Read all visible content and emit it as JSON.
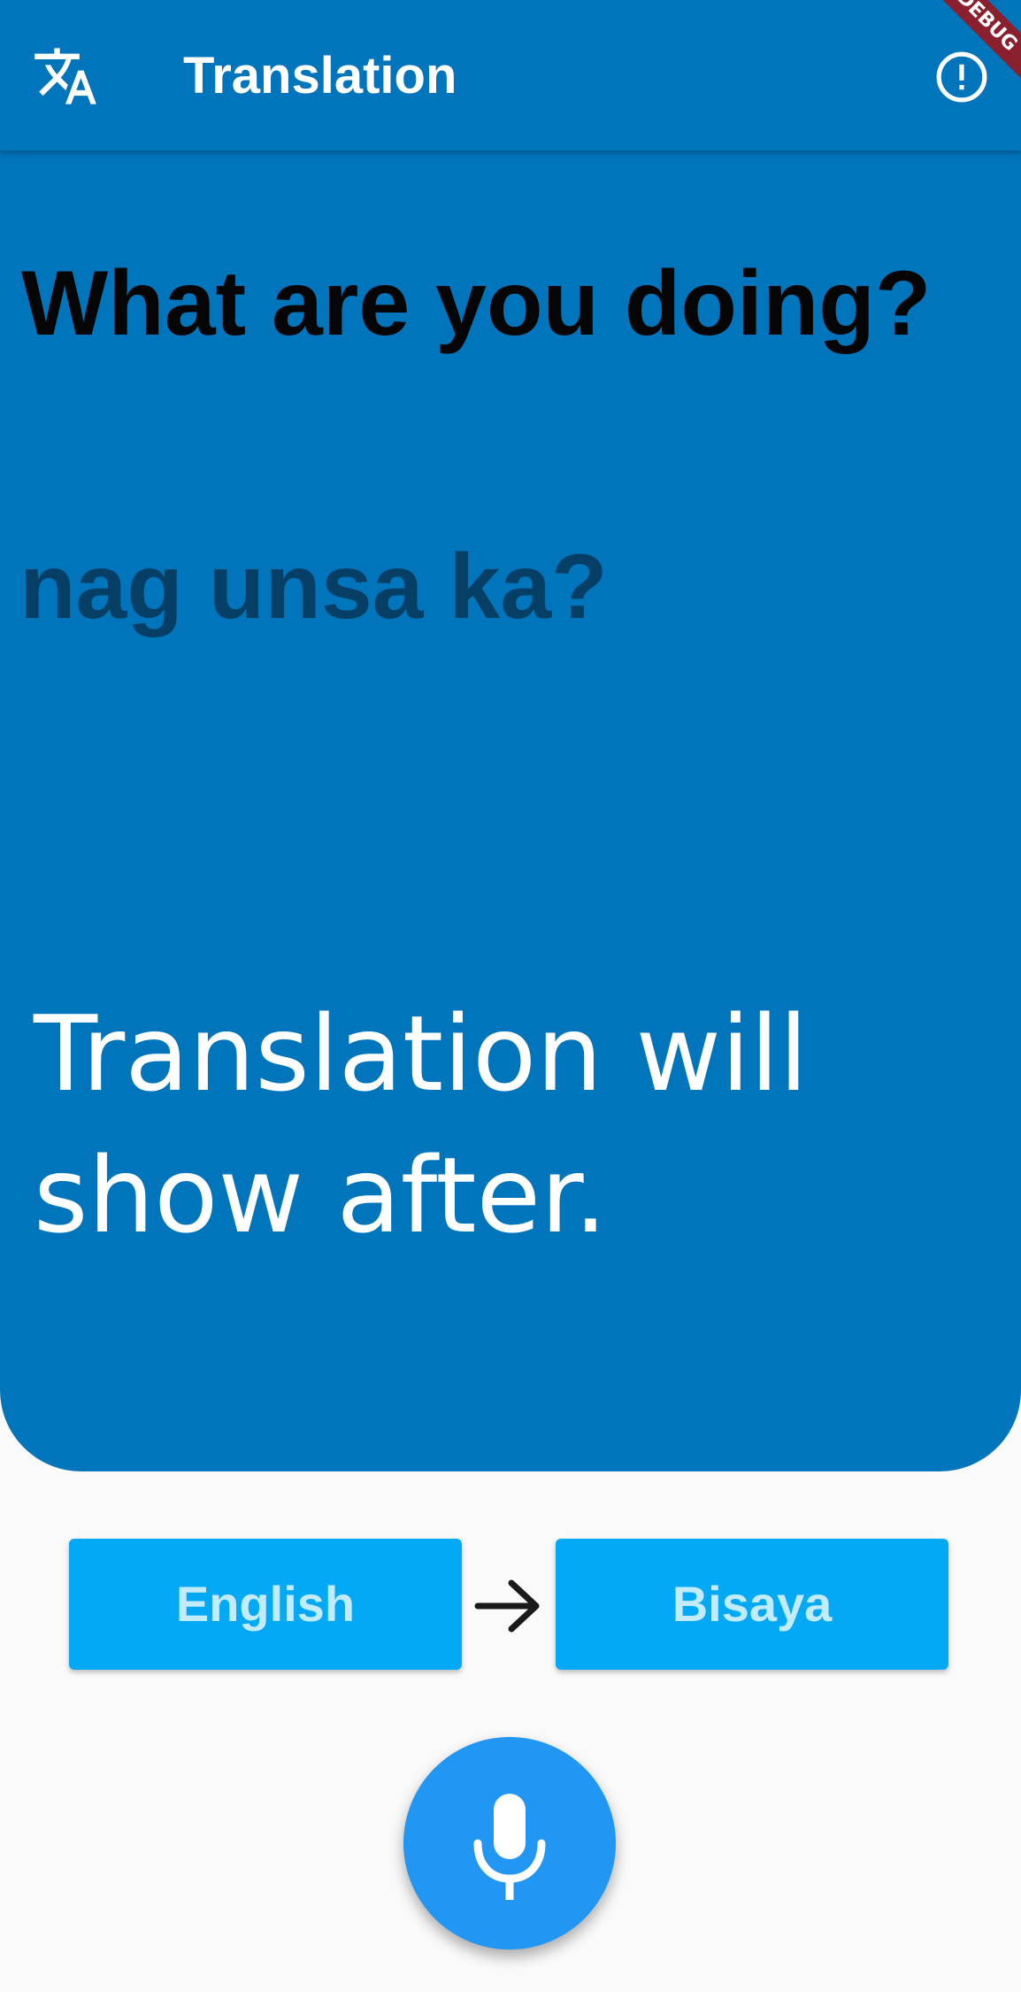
{
  "app_bar": {
    "title": "Translation",
    "leading_icon": "translate-icon",
    "trailing_icon": "info-icon"
  },
  "debug_banner": "DEBUG",
  "translation_panel": {
    "source_text": "What are you doing?",
    "translated_text": "nag unsa ka?",
    "hint": "Translation will show after."
  },
  "language_selector": {
    "source_language": "English",
    "target_language": "Bisaya",
    "swap_icon": "arrow-right-icon"
  },
  "mic_button": {
    "icon": "microphone-icon"
  },
  "colors": {
    "primary": "#0175bc",
    "language_button": "#03a9f4",
    "fab": "#2196f3",
    "background": "#fafafa"
  }
}
